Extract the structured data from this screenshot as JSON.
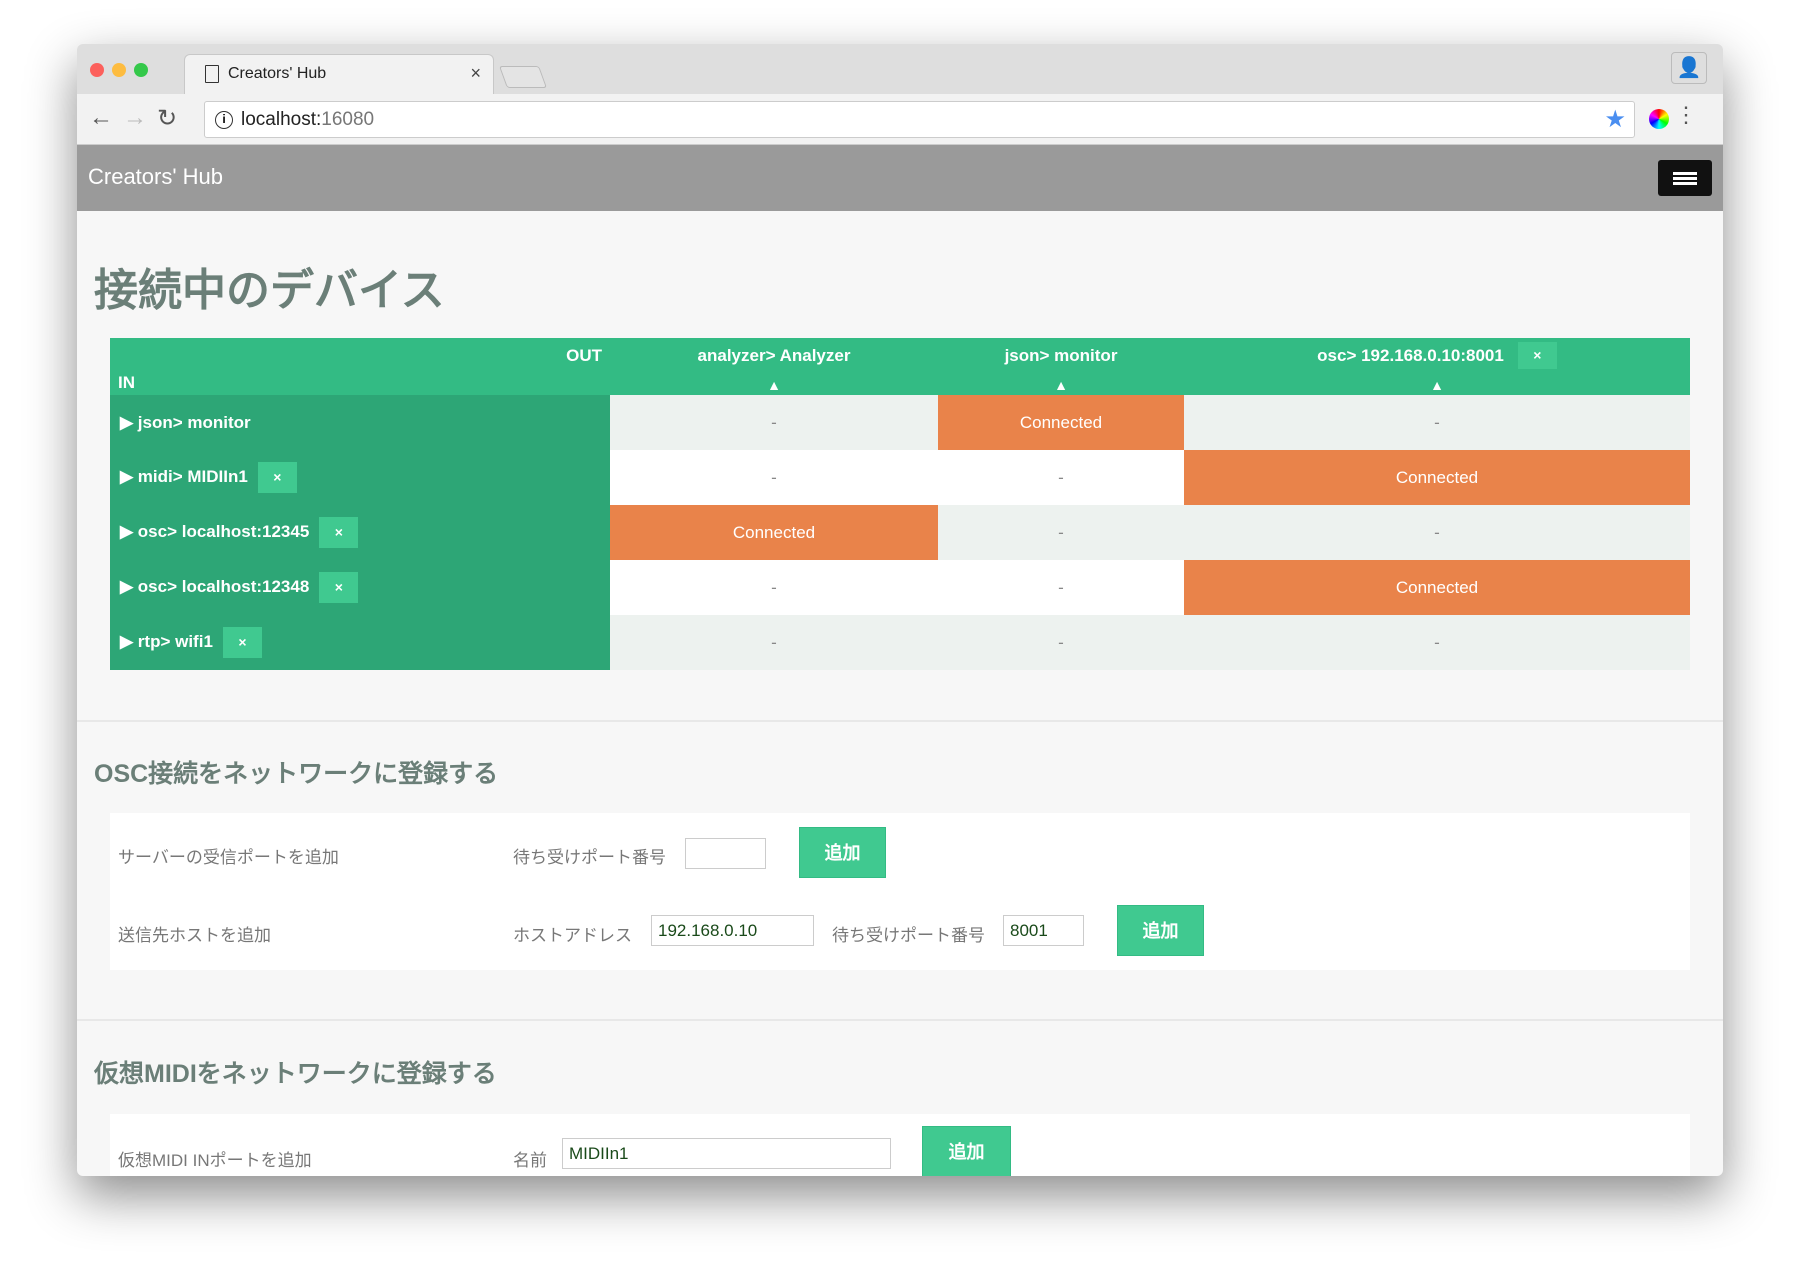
{
  "browser": {
    "tab_title": "Creators' Hub",
    "url_host": "localhost:",
    "url_port": "16080"
  },
  "navbar": {
    "brand": "Creators' Hub"
  },
  "devices": {
    "title": "接続中のデバイス",
    "out_label": "OUT",
    "in_label": "IN",
    "columns": [
      {
        "label": "analyzer> Analyzer",
        "removable": false
      },
      {
        "label": "json> monitor",
        "removable": false
      },
      {
        "label": "osc> 192.168.0.10:8001",
        "removable": true
      }
    ],
    "rows": [
      {
        "label": "json> monitor",
        "removable": false,
        "cells": [
          "-",
          "Connected",
          "-"
        ]
      },
      {
        "label": "midi> MIDIIn1",
        "removable": true,
        "cells": [
          "-",
          "-",
          "Connected"
        ]
      },
      {
        "label": "osc> localhost:12345",
        "removable": true,
        "cells": [
          "Connected",
          "-",
          "-"
        ]
      },
      {
        "label": "osc> localhost:12348",
        "removable": true,
        "cells": [
          "-",
          "-",
          "Connected"
        ]
      },
      {
        "label": "rtp> wifi1",
        "removable": true,
        "cells": [
          "-",
          "-",
          "-"
        ]
      }
    ],
    "remove_label": "×",
    "expand_icon": "triangle-right",
    "sort_icon": "triangle-up"
  },
  "osc": {
    "title": "OSC接続をネットワークに登録する",
    "server": {
      "label": "サーバーの受信ポートを追加",
      "port_label": "待ち受けポート番号",
      "port_value": "",
      "button": "追加"
    },
    "client": {
      "label": "送信先ホストを追加",
      "host_label": "ホストアドレス",
      "host_value": "192.168.0.10",
      "port_label": "待ち受けポート番号",
      "port_value": "8001",
      "button": "追加"
    }
  },
  "midi": {
    "title": "仮想MIDIをネットワークに登録する",
    "in": {
      "label": "仮想MIDI INポートを追加",
      "name_label": "名前",
      "name_value": "MIDIIn1",
      "button": "追加"
    }
  },
  "colors": {
    "header_green": "#33bb84",
    "in_green": "#2da676",
    "connected": "#e9834a",
    "button": "#40c990",
    "navbar": "#9a9a9a"
  }
}
